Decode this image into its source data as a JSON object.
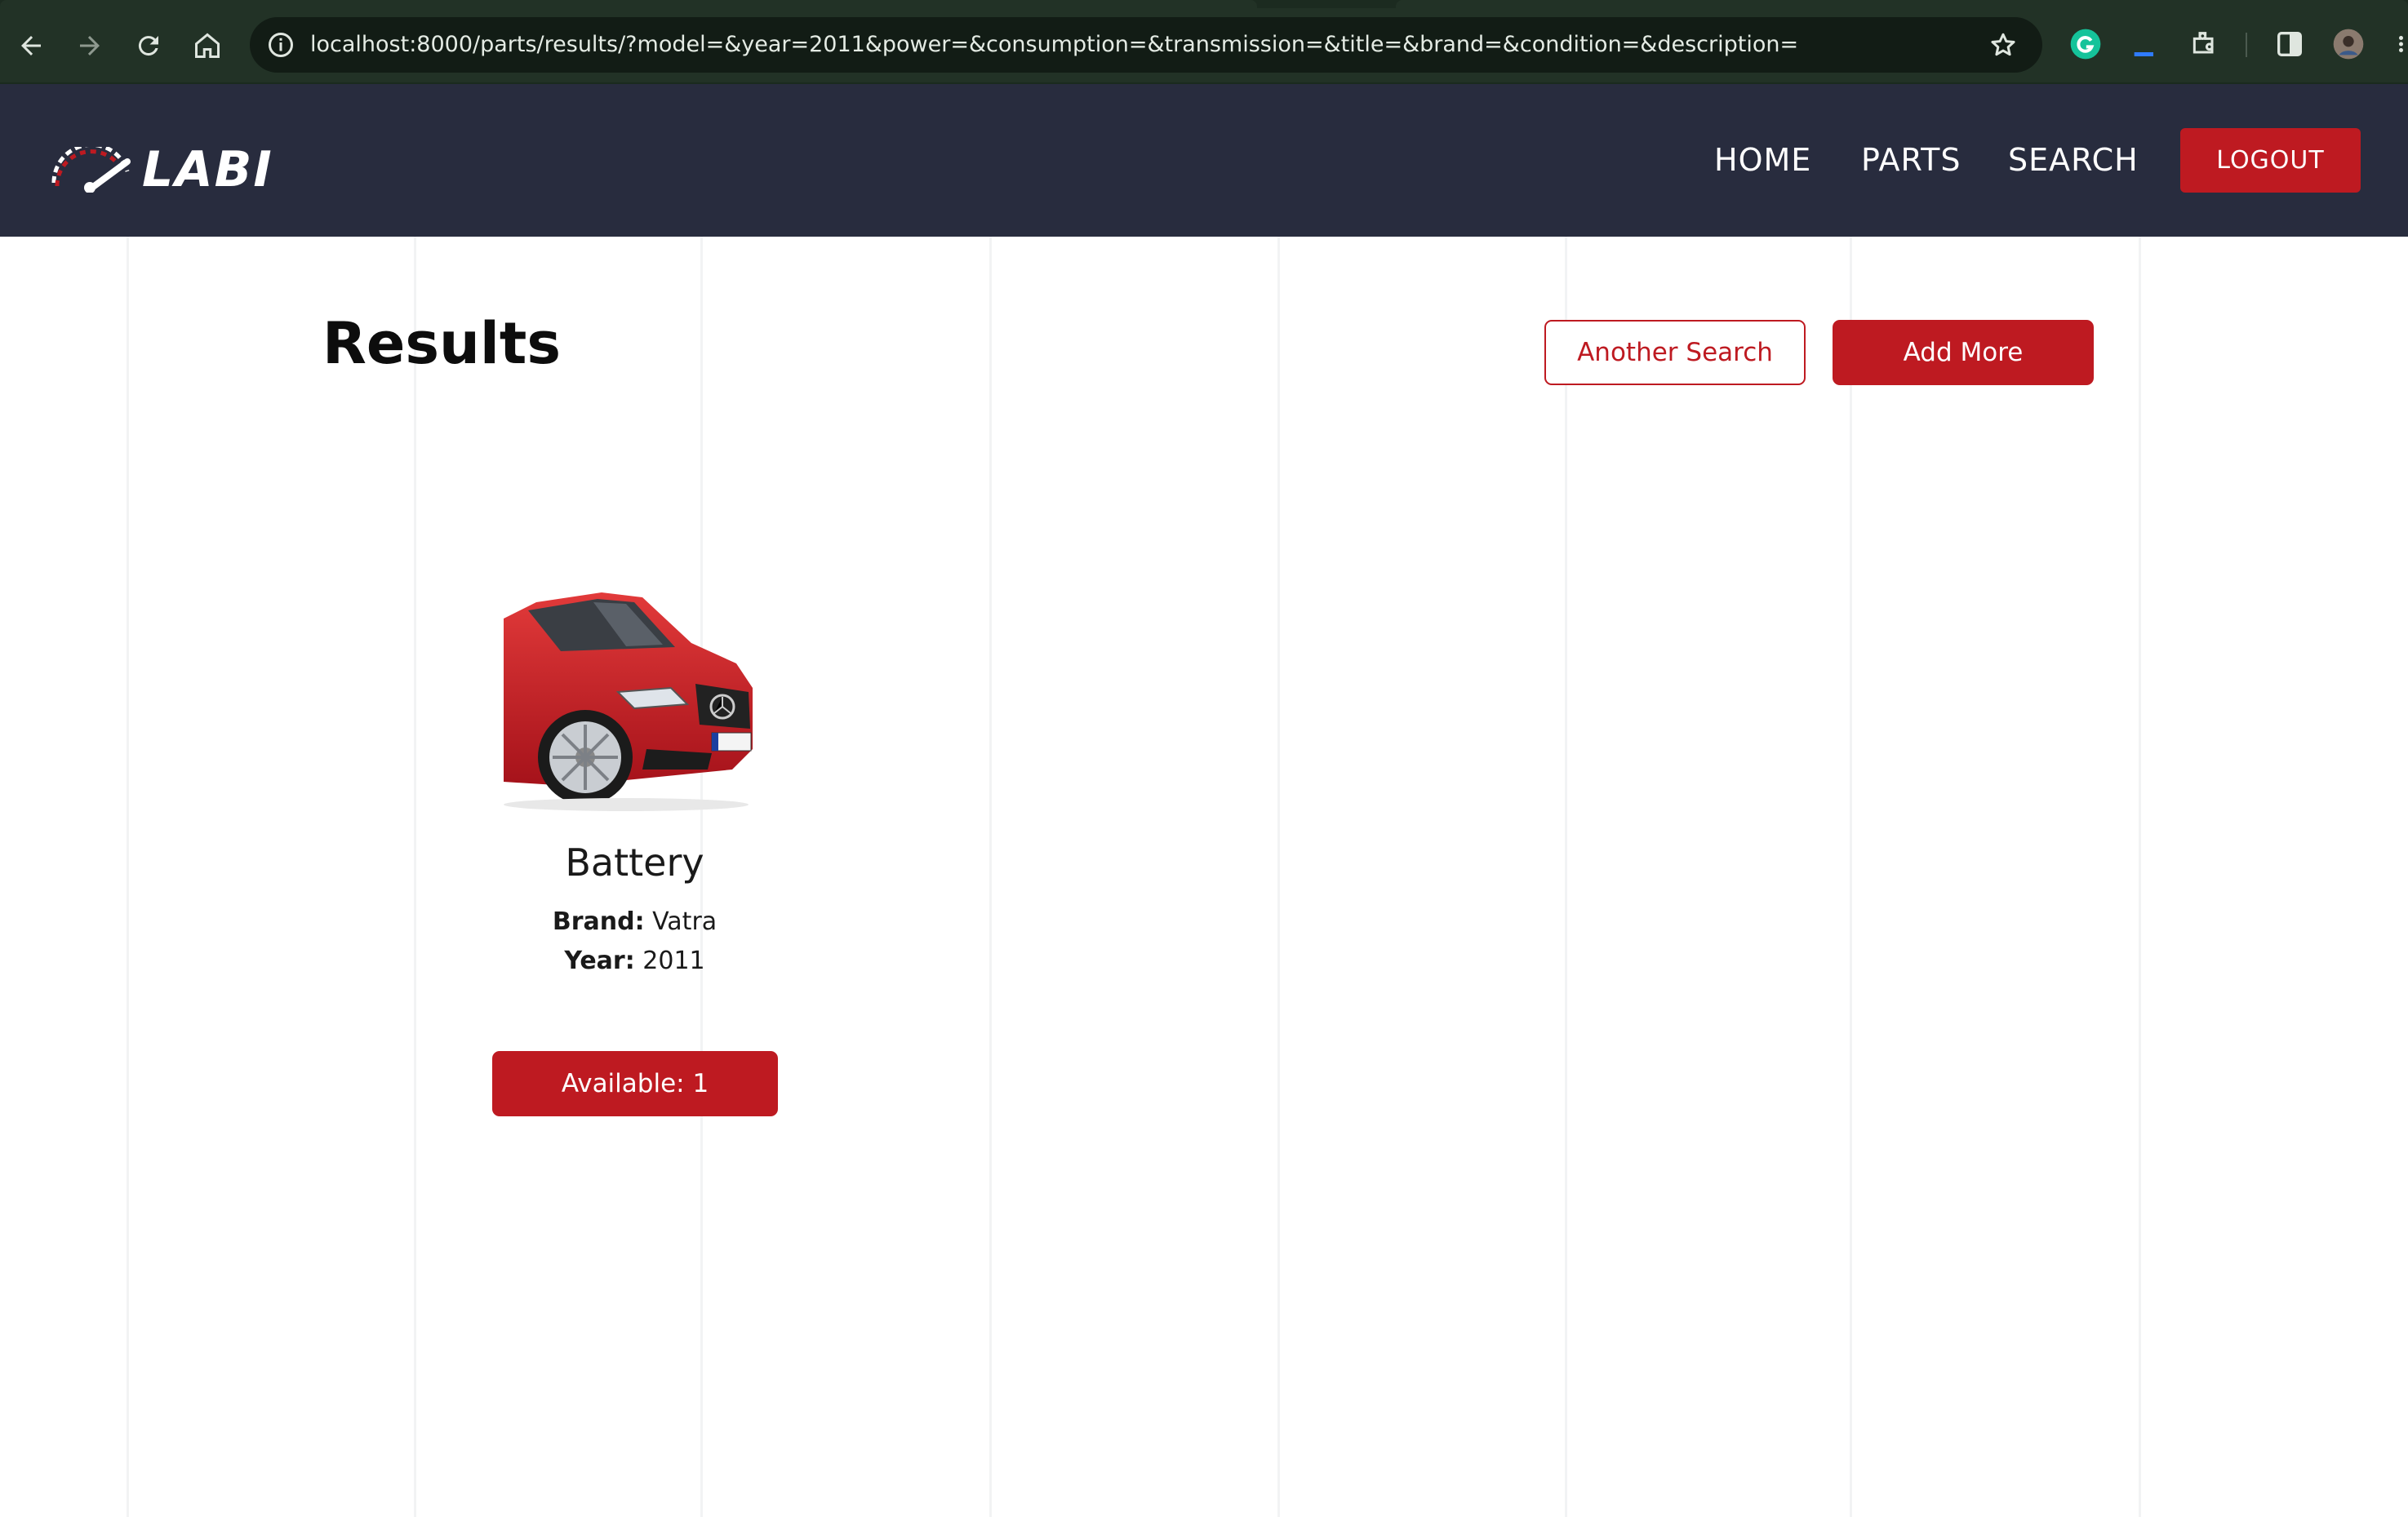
{
  "browser": {
    "url": "localhost:8000/parts/results/?model=&year=2011&power=&consumption=&transmission=&title=&brand=&condition=&description=",
    "icons": [
      "back-icon",
      "forward-icon",
      "reload-icon",
      "home-icon",
      "site-info-icon",
      "bookmark-star-icon",
      "grammarly-icon",
      "extension-icon",
      "puzzle-icon",
      "side-panel-icon",
      "profile-avatar",
      "menu-icon"
    ]
  },
  "header": {
    "logo_text": "LABI",
    "nav": [
      "HOME",
      "PARTS",
      "SEARCH"
    ],
    "logout_label": "LOGOUT"
  },
  "page": {
    "title": "Results",
    "another_search_label": "Another Search",
    "add_more_label": "Add More"
  },
  "results": [
    {
      "title": "Battery",
      "brand_label": "Brand:",
      "brand": "Vatra",
      "year_label": "Year:",
      "year": "2011",
      "available_label": "Available: 1"
    }
  ],
  "colors": {
    "header_bg": "#282c3e",
    "accent_red": "#be1a21",
    "browser_bg": "#223226"
  }
}
